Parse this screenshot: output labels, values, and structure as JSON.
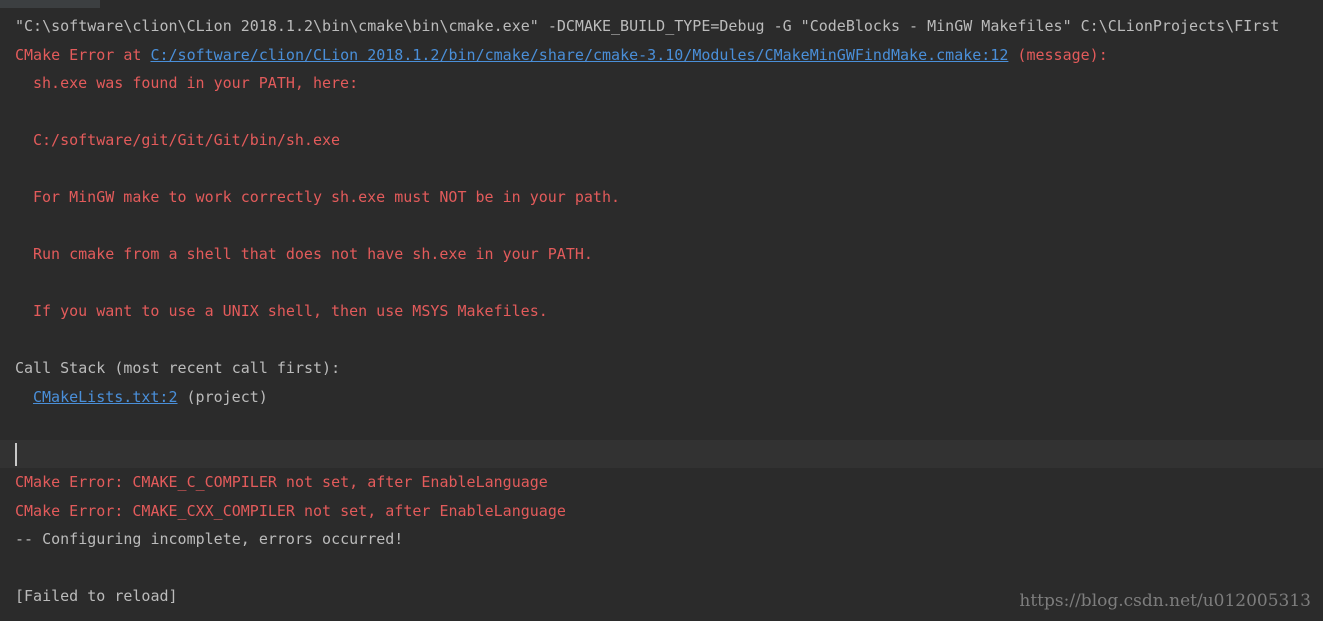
{
  "console": {
    "command": "\"C:\\software\\clion\\CLion 2018.1.2\\bin\\cmake\\bin\\cmake.exe\" -DCMAKE_BUILD_TYPE=Debug -G \"CodeBlocks - MinGW Makefiles\" C:\\CLionProjects\\FIrst",
    "error_prefix": "CMake Error at ",
    "error_link": "C:/software/clion/CLion 2018.1.2/bin/cmake/share/cmake-3.10/Modules/CMakeMinGWFindMake.cmake:12",
    "error_suffix": " (message):",
    "msg_sh_found": "sh.exe was found in your PATH, here:",
    "msg_sh_path": "C:/software/git/Git/Git/bin/sh.exe",
    "msg_mingw": "For MinGW make to work correctly sh.exe must NOT be in your path.",
    "msg_run": "Run cmake from a shell that does not have sh.exe in your PATH.",
    "msg_unix": "If you want to use a UNIX shell, then use MSYS Makefiles.",
    "call_stack": "Call Stack (most recent call first):",
    "stack_link": "CMakeLists.txt:2",
    "stack_suffix": " (project)",
    "err_c_compiler": "CMake Error: CMAKE_C_COMPILER not set, after EnableLanguage",
    "err_cxx_compiler": "CMake Error: CMAKE_CXX_COMPILER not set, after EnableLanguage",
    "configuring": "-- Configuring incomplete, errors occurred!",
    "failed": "[Failed to reload]"
  },
  "watermark": "https://blog.csdn.net/u012005313",
  "colors": {
    "background": "#2b2b2b",
    "error_text": "#e35b5b",
    "plain_text": "#bbbbbb",
    "link": "#4a8fd9"
  }
}
